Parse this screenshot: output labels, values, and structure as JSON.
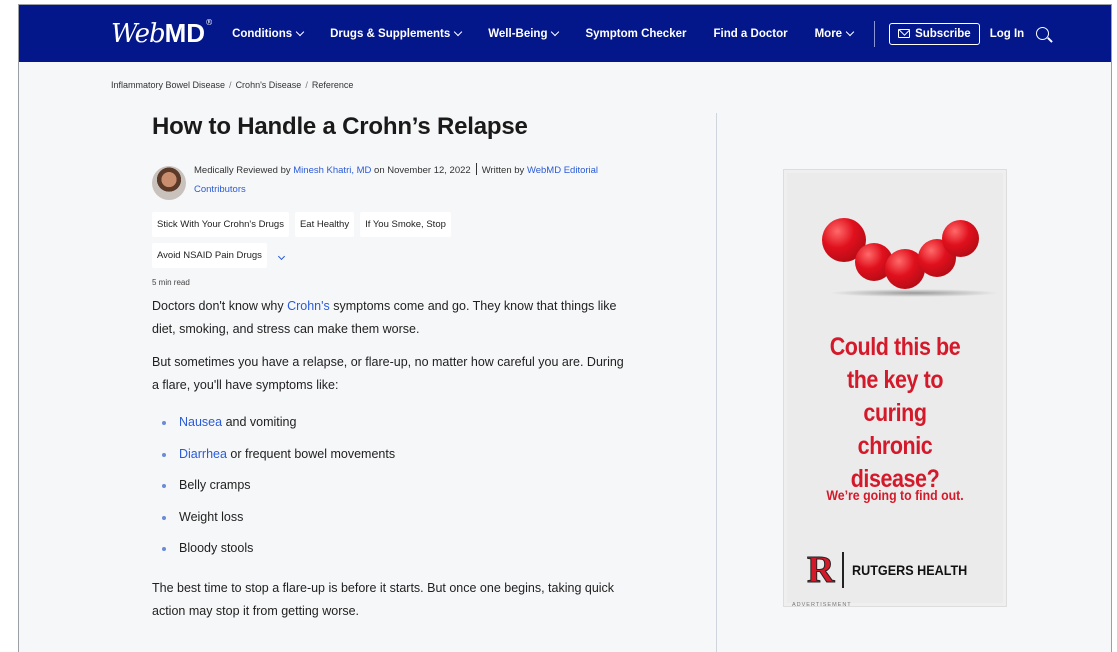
{
  "nav": {
    "logo_web": "Web",
    "logo_md": "MD",
    "logo_mark": "®",
    "items": [
      {
        "label": "Conditions",
        "dropdown": true
      },
      {
        "label": "Drugs & Supplements",
        "dropdown": true
      },
      {
        "label": "Well-Being",
        "dropdown": true
      },
      {
        "label": "Symptom Checker",
        "dropdown": false
      },
      {
        "label": "Find a Doctor",
        "dropdown": false
      },
      {
        "label": "More",
        "dropdown": true
      }
    ],
    "subscribe_label": "Subscribe",
    "login_label": "Log In",
    "bg_color": "#03178a"
  },
  "breadcrumb": [
    "Inflammatory Bowel Disease",
    "Crohn's Disease",
    "Reference"
  ],
  "article": {
    "title": "How to Handle a Crohn’s Relapse",
    "byline": {
      "reviewed_prefix": "Medically Reviewed by ",
      "reviewer": "Minesh Khatri, MD",
      "date_text": " on November 12, 2022",
      "written_prefix": "Written by ",
      "author": "WebMD Editorial Contributors"
    },
    "toc": [
      "Stick With Your Crohn's Drugs",
      "Eat Healthy",
      "If You Smoke, Stop",
      "Avoid NSAID Pain Drugs"
    ],
    "read_time": "5 min read",
    "p1_before": "Doctors don't know why ",
    "p1_link": "Crohn's",
    "p1_after": " symptoms come and go. They know that things like diet, smoking, and stress can make them worse.",
    "p2": "But sometimes you have a relapse, or flare-up, no matter how careful you are. During a flare, you'll have symptoms like:",
    "bullets": [
      {
        "link": "Nausea",
        "text": " and vomiting"
      },
      {
        "link": "Diarrhea",
        "text": " or frequent bowel movements"
      },
      {
        "link": "",
        "text": "Belly cramps"
      },
      {
        "link": "",
        "text": "Weight loss"
      },
      {
        "link": "",
        "text": "Bloody stools"
      }
    ],
    "p3": "The best time to stop a flare-up is before it starts. But once one begins, taking quick action may stop it from getting worse."
  },
  "ad": {
    "headline": "Could this be the key to curing chronic disease?",
    "subline": "We’re going to find out.",
    "logo_letter": "R",
    "logo_text": "RUTGERS HEALTH",
    "label": "ADVERTISEMENT",
    "accent_color": "#d41a2a"
  },
  "colors": {
    "link": "#2a5bd7",
    "page_bg": "#f6f7f9"
  }
}
